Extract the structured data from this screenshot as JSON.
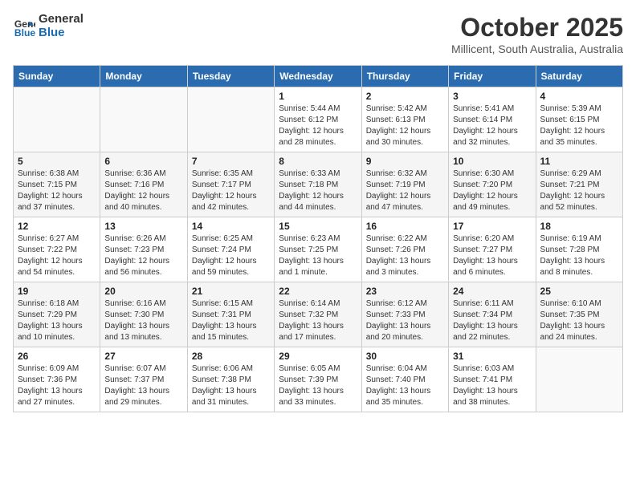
{
  "logo": {
    "line1": "General",
    "line2": "Blue"
  },
  "title": "October 2025",
  "subtitle": "Millicent, South Australia, Australia",
  "days_header": [
    "Sunday",
    "Monday",
    "Tuesday",
    "Wednesday",
    "Thursday",
    "Friday",
    "Saturday"
  ],
  "weeks": [
    [
      {
        "day": "",
        "info": ""
      },
      {
        "day": "",
        "info": ""
      },
      {
        "day": "",
        "info": ""
      },
      {
        "day": "1",
        "info": "Sunrise: 5:44 AM\nSunset: 6:12 PM\nDaylight: 12 hours\nand 28 minutes."
      },
      {
        "day": "2",
        "info": "Sunrise: 5:42 AM\nSunset: 6:13 PM\nDaylight: 12 hours\nand 30 minutes."
      },
      {
        "day": "3",
        "info": "Sunrise: 5:41 AM\nSunset: 6:14 PM\nDaylight: 12 hours\nand 32 minutes."
      },
      {
        "day": "4",
        "info": "Sunrise: 5:39 AM\nSunset: 6:15 PM\nDaylight: 12 hours\nand 35 minutes."
      }
    ],
    [
      {
        "day": "5",
        "info": "Sunrise: 6:38 AM\nSunset: 7:15 PM\nDaylight: 12 hours\nand 37 minutes."
      },
      {
        "day": "6",
        "info": "Sunrise: 6:36 AM\nSunset: 7:16 PM\nDaylight: 12 hours\nand 40 minutes."
      },
      {
        "day": "7",
        "info": "Sunrise: 6:35 AM\nSunset: 7:17 PM\nDaylight: 12 hours\nand 42 minutes."
      },
      {
        "day": "8",
        "info": "Sunrise: 6:33 AM\nSunset: 7:18 PM\nDaylight: 12 hours\nand 44 minutes."
      },
      {
        "day": "9",
        "info": "Sunrise: 6:32 AM\nSunset: 7:19 PM\nDaylight: 12 hours\nand 47 minutes."
      },
      {
        "day": "10",
        "info": "Sunrise: 6:30 AM\nSunset: 7:20 PM\nDaylight: 12 hours\nand 49 minutes."
      },
      {
        "day": "11",
        "info": "Sunrise: 6:29 AM\nSunset: 7:21 PM\nDaylight: 12 hours\nand 52 minutes."
      }
    ],
    [
      {
        "day": "12",
        "info": "Sunrise: 6:27 AM\nSunset: 7:22 PM\nDaylight: 12 hours\nand 54 minutes."
      },
      {
        "day": "13",
        "info": "Sunrise: 6:26 AM\nSunset: 7:23 PM\nDaylight: 12 hours\nand 56 minutes."
      },
      {
        "day": "14",
        "info": "Sunrise: 6:25 AM\nSunset: 7:24 PM\nDaylight: 12 hours\nand 59 minutes."
      },
      {
        "day": "15",
        "info": "Sunrise: 6:23 AM\nSunset: 7:25 PM\nDaylight: 13 hours\nand 1 minute."
      },
      {
        "day": "16",
        "info": "Sunrise: 6:22 AM\nSunset: 7:26 PM\nDaylight: 13 hours\nand 3 minutes."
      },
      {
        "day": "17",
        "info": "Sunrise: 6:20 AM\nSunset: 7:27 PM\nDaylight: 13 hours\nand 6 minutes."
      },
      {
        "day": "18",
        "info": "Sunrise: 6:19 AM\nSunset: 7:28 PM\nDaylight: 13 hours\nand 8 minutes."
      }
    ],
    [
      {
        "day": "19",
        "info": "Sunrise: 6:18 AM\nSunset: 7:29 PM\nDaylight: 13 hours\nand 10 minutes."
      },
      {
        "day": "20",
        "info": "Sunrise: 6:16 AM\nSunset: 7:30 PM\nDaylight: 13 hours\nand 13 minutes."
      },
      {
        "day": "21",
        "info": "Sunrise: 6:15 AM\nSunset: 7:31 PM\nDaylight: 13 hours\nand 15 minutes."
      },
      {
        "day": "22",
        "info": "Sunrise: 6:14 AM\nSunset: 7:32 PM\nDaylight: 13 hours\nand 17 minutes."
      },
      {
        "day": "23",
        "info": "Sunrise: 6:12 AM\nSunset: 7:33 PM\nDaylight: 13 hours\nand 20 minutes."
      },
      {
        "day": "24",
        "info": "Sunrise: 6:11 AM\nSunset: 7:34 PM\nDaylight: 13 hours\nand 22 minutes."
      },
      {
        "day": "25",
        "info": "Sunrise: 6:10 AM\nSunset: 7:35 PM\nDaylight: 13 hours\nand 24 minutes."
      }
    ],
    [
      {
        "day": "26",
        "info": "Sunrise: 6:09 AM\nSunset: 7:36 PM\nDaylight: 13 hours\nand 27 minutes."
      },
      {
        "day": "27",
        "info": "Sunrise: 6:07 AM\nSunset: 7:37 PM\nDaylight: 13 hours\nand 29 minutes."
      },
      {
        "day": "28",
        "info": "Sunrise: 6:06 AM\nSunset: 7:38 PM\nDaylight: 13 hours\nand 31 minutes."
      },
      {
        "day": "29",
        "info": "Sunrise: 6:05 AM\nSunset: 7:39 PM\nDaylight: 13 hours\nand 33 minutes."
      },
      {
        "day": "30",
        "info": "Sunrise: 6:04 AM\nSunset: 7:40 PM\nDaylight: 13 hours\nand 35 minutes."
      },
      {
        "day": "31",
        "info": "Sunrise: 6:03 AM\nSunset: 7:41 PM\nDaylight: 13 hours\nand 38 minutes."
      },
      {
        "day": "",
        "info": ""
      }
    ]
  ]
}
